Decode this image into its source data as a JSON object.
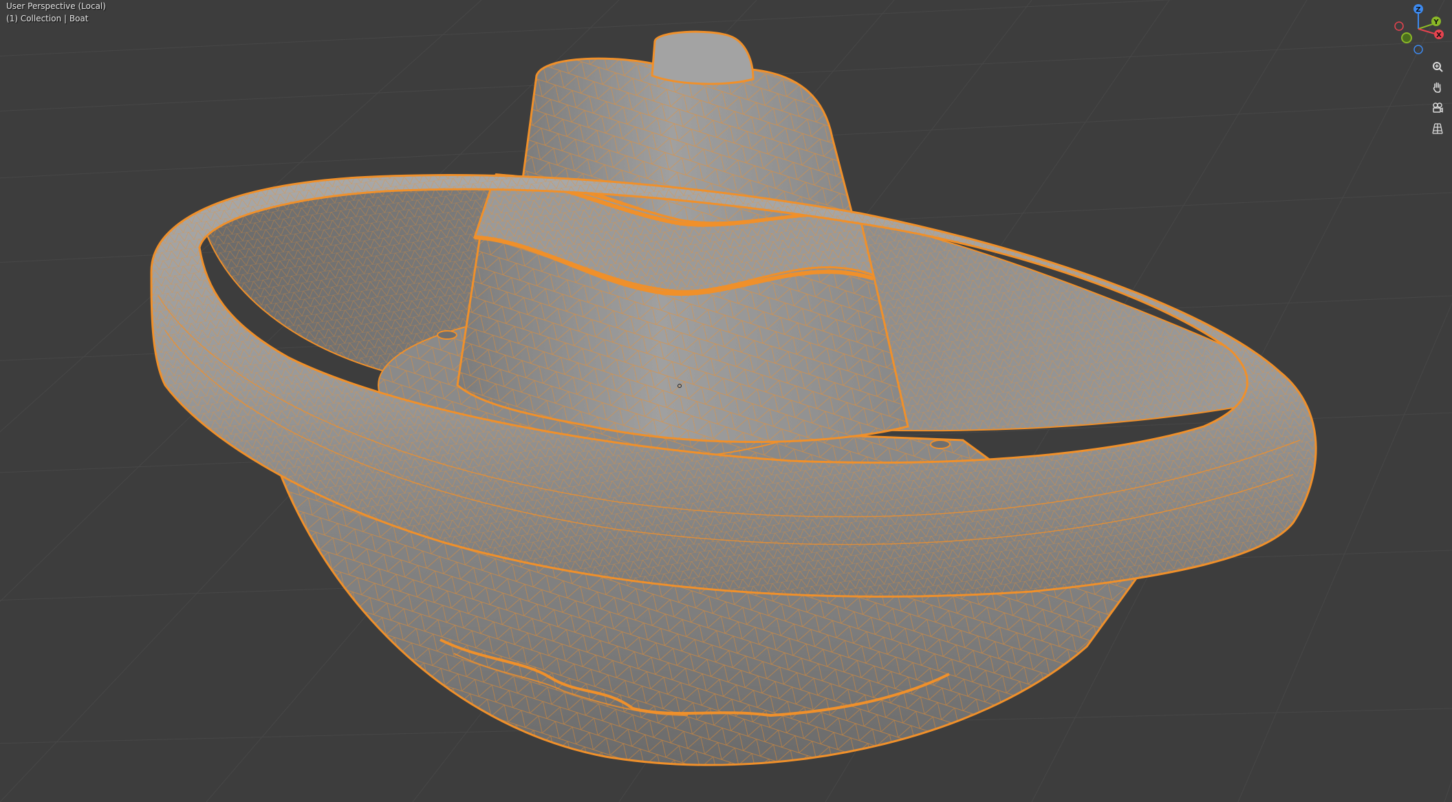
{
  "viewport": {
    "view_label": "User Perspective (Local)",
    "collection_label": "(1) Collection | Boat",
    "grid_color": "#484848",
    "background_color": "#3d3d3d",
    "mesh_fill_color": "#8f8f8f",
    "wire_color": "#f0902a"
  },
  "gizmo": {
    "axis_z": "Z",
    "axis_y": "Y",
    "axis_x": "X",
    "color_x": "#e8434f",
    "color_y": "#8bb927",
    "color_z": "#3d8af0"
  },
  "nav_buttons": [
    {
      "name": "zoom-icon"
    },
    {
      "name": "hand-pan-icon"
    },
    {
      "name": "camera-view-icon"
    },
    {
      "name": "grid-perspective-icon"
    }
  ]
}
